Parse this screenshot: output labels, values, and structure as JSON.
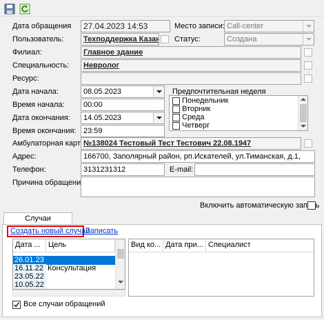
{
  "toolbar": {
    "save_icon": "floppy-disk-icon",
    "refresh_icon": "refresh-icon"
  },
  "labels": {
    "date": "Дата обращения",
    "user": "Пользователь:",
    "branch": "Филиал:",
    "specialty": "Специальность:",
    "resource": "Ресурс:",
    "start_date": "Дата начала:",
    "start_time": "Время начала:",
    "end_date": "Дата окончания:",
    "end_time": "Время окончания:",
    "card": "Амбулаторная карта:",
    "address": "Адрес:",
    "phone": "Телефон:",
    "email": "E-mail:",
    "reason": "Причина обращения:",
    "record_place": "Место записи:",
    "status": "Статус:",
    "pref_week": "Предпочтительная неделя",
    "auto_record": "Включить автоматическую запись"
  },
  "values": {
    "date": "27.04.2023 14:53",
    "user": "Техподдержка Казань",
    "branch": "Главное здание",
    "specialty": "Невролог",
    "resource": "",
    "start_date": "08.05.2023",
    "start_time": "00:00",
    "end_date": "14.05.2023",
    "end_time": "23:59",
    "card": "№138024 Тестовый Тест Тестович 22.08.1947",
    "address": "166700, Заполярный район, рп.Искателей, ул.Тиманская, д.1,",
    "phone": "3131231312",
    "email": "",
    "reason": "",
    "record_place": "Call-center",
    "status": "Создана"
  },
  "weekdays": [
    "Понедельник",
    "Вторник",
    "Среда",
    "Четверг"
  ],
  "tab": {
    "label": "Случаи обращения"
  },
  "links": {
    "create_case": "Создать новый случай",
    "record": "Записать"
  },
  "cases_table": {
    "headers": [
      "Дата ...",
      "Цель"
    ],
    "rows": [
      {
        "date": "26.01.23",
        "goal": ""
      },
      {
        "date": "16.11.22",
        "goal": "Консультация"
      },
      {
        "date": "23.05.22",
        "goal": ""
      },
      {
        "date": "10.05.22",
        "goal": ""
      }
    ]
  },
  "right_table": {
    "headers": [
      "Вид ко...",
      "Дата при...",
      "Специалист"
    ]
  },
  "all_cases_label": "Все случаи обращений",
  "colors": {
    "link": "#0033cc",
    "selected_row": "#0078d7",
    "highlight_box": "#e00000"
  }
}
